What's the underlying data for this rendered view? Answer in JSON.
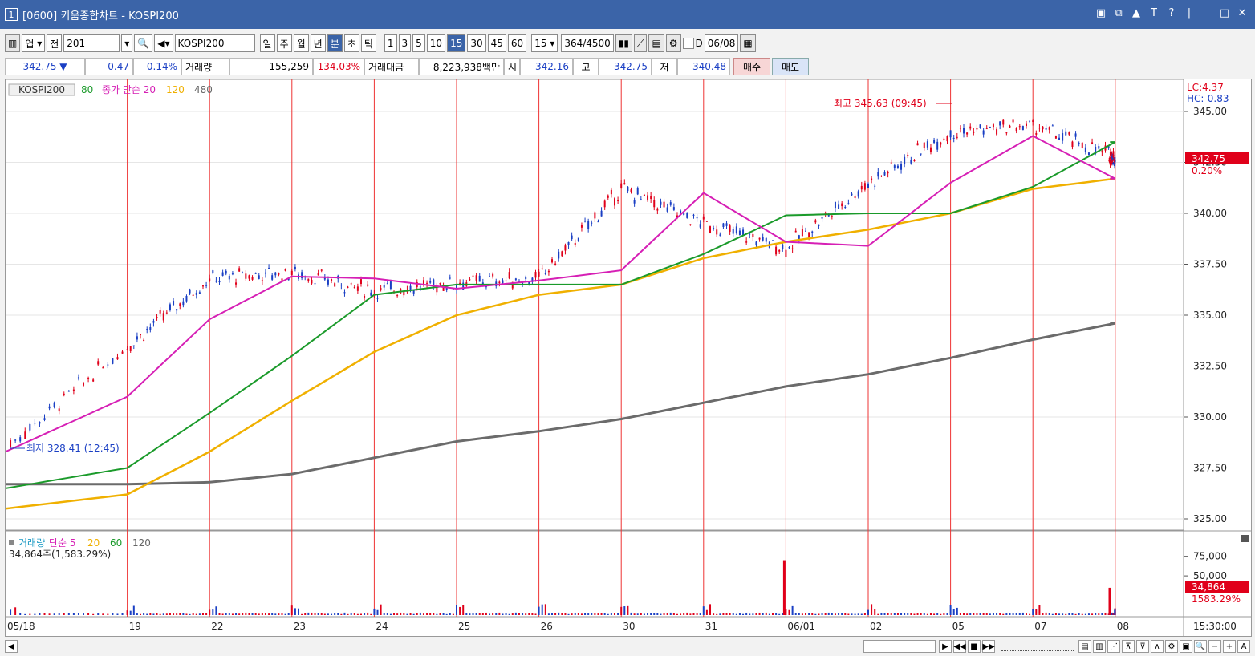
{
  "window": {
    "number": "1",
    "title": "[0600] 키움종합차트 - KOSPI200"
  },
  "toolbar": {
    "market": "업",
    "jeon": "전",
    "code": "201",
    "name": "KOSPI200",
    "periods": [
      "일",
      "주",
      "월",
      "년",
      "분",
      "초",
      "틱"
    ],
    "active_period": "분",
    "intervals": [
      "1",
      "3",
      "5",
      "10",
      "15",
      "30",
      "45",
      "60"
    ],
    "active_interval": "15",
    "interval_select": "15",
    "count": "364",
    "count_total": "/4500",
    "d_label": "D",
    "date": "06/08"
  },
  "quote": {
    "price": "342.75",
    "change": "0.47",
    "change_pct": "-0.14%",
    "volume_label": "거래량",
    "volume": "155,259",
    "volume_pct": "134.03%",
    "amount_label": "거래대금",
    "amount": "8,223,938백만",
    "open_label": "시",
    "open": "342.16",
    "high_label": "고",
    "high": "342.75",
    "low_label": "저",
    "low": "340.48",
    "buy": "매수",
    "sell": "매도"
  },
  "price_legend": {
    "symbol": "KOSPI200",
    "ma": [
      {
        "label": "80",
        "color": "#1a9a2a"
      },
      {
        "label": "종가 단순 20",
        "color": "#d61fb5"
      },
      {
        "label": "120",
        "color": "#f0b000"
      },
      {
        "label": "480",
        "color": "#666666"
      }
    ]
  },
  "volume_legend": {
    "items": [
      {
        "label": "거래량",
        "color": "#1a9ac4"
      },
      {
        "label": "단순 5",
        "color": "#d61fb5"
      },
      {
        "label": "20",
        "color": "#f0b000"
      },
      {
        "label": "60",
        "color": "#1a9a2a"
      },
      {
        "label": "120",
        "color": "#666666"
      }
    ],
    "last": "34,864주(1,583.29%)"
  },
  "side_info": {
    "lc": "LC:4.37",
    "hc": "HC:-0.83"
  },
  "annotations": {
    "high": "최고 345.63 (09:45)",
    "low": "최저 328.41 (12:45)"
  },
  "price_tag": {
    "value": "342.75",
    "pct": "0.20%"
  },
  "volume_tag": {
    "value": "34,864",
    "pct": "1583.29%"
  },
  "time_label": "15:30:00",
  "chart_data": {
    "type": "candlestick",
    "x_dates": [
      "05/18",
      "19",
      "22",
      "23",
      "24",
      "25",
      "26",
      "30",
      "31",
      "06/01",
      "02",
      "05",
      "07",
      "08"
    ],
    "y_ticks": [
      "345.00",
      "342.50",
      "340.00",
      "337.50",
      "335.00",
      "332.50",
      "330.00",
      "327.50",
      "325.00"
    ],
    "ylim": [
      325.0,
      345.6
    ],
    "daily_close": [
      328.5,
      333.5,
      336.8,
      337.1,
      336.2,
      336.6,
      336.8,
      341.2,
      339.5,
      338.3,
      341.5,
      344.0,
      344.3,
      342.75
    ],
    "ma20_daily": [
      328.3,
      331.0,
      334.8,
      336.9,
      336.8,
      336.3,
      336.7,
      337.2,
      341.0,
      338.6,
      338.4,
      341.5,
      343.8,
      341.7
    ],
    "ma80_daily": [
      326.5,
      327.5,
      330.2,
      333.0,
      336.0,
      336.5,
      336.5,
      336.5,
      338.0,
      339.9,
      340.0,
      340.0,
      341.3,
      343.5
    ],
    "ma120_daily": [
      325.5,
      326.2,
      328.3,
      330.8,
      333.2,
      335.0,
      336.0,
      336.5,
      337.8,
      338.6,
      339.2,
      340.0,
      341.2,
      341.7
    ],
    "ma480_daily": [
      326.7,
      326.7,
      326.8,
      327.2,
      328.0,
      328.8,
      329.3,
      329.9,
      330.7,
      331.5,
      332.1,
      332.9,
      333.8,
      334.6
    ],
    "volume_ticks": [
      "75,000",
      "50,000"
    ],
    "volume_spikes": [
      {
        "date": "06/01",
        "value": 70000
      },
      {
        "date": "08",
        "value": 34864
      }
    ]
  }
}
